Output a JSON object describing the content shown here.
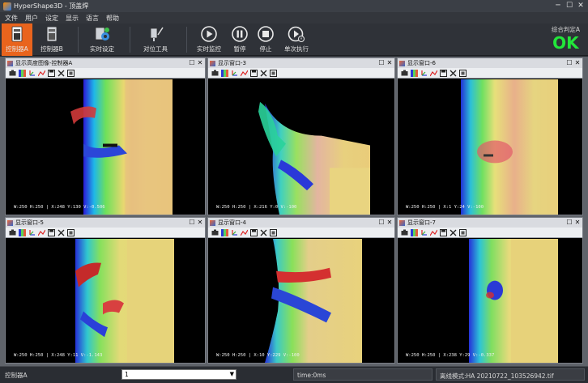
{
  "window": {
    "title": "HyperShape3D - 顶盖焊"
  },
  "menu": [
    "文件",
    "用户",
    "设定",
    "显示",
    "语言",
    "帮助"
  ],
  "toolbar": {
    "buttons": [
      {
        "label": "控制器A",
        "icon": "controller-icon",
        "active": true
      },
      {
        "label": "控制器B",
        "icon": "controller-icon",
        "active": false
      },
      {
        "label": "实时设定",
        "icon": "settings-icon",
        "active": false
      },
      {
        "label": "对位工具",
        "icon": "alignment-tool-icon",
        "active": false
      },
      {
        "label": "实时监控",
        "icon": "play-icon",
        "active": false
      },
      {
        "label": "暂停",
        "icon": "pause-icon",
        "active": false
      },
      {
        "label": "停止",
        "icon": "stop-icon",
        "active": false
      },
      {
        "label": "单次执行",
        "icon": "single-run-icon",
        "active": false
      }
    ]
  },
  "verdict": {
    "label": "综合判定A",
    "value": "OK",
    "color": "#22e63a"
  },
  "panes": [
    {
      "title": "显示高度图像-控制器A",
      "readout": "W:250 H:250  |  X:248 Y:130 V:-0.506",
      "variant": "a"
    },
    {
      "title": "显示窗口-3",
      "readout": "W:250 H:250  |  X:216 Y:0 V:-100",
      "variant": "b"
    },
    {
      "title": "显示窗口-6",
      "readout": "W:250 H:250  |  X:1 Y:24 V:-100",
      "variant": "c"
    },
    {
      "title": "显示窗口-5",
      "readout": "W:250 H:250  |  X:248 Y:11 V:-1.143",
      "variant": "d"
    },
    {
      "title": "显示窗口-4",
      "readout": "W:250 H:250  |  X:10 Y:229 V:-100",
      "variant": "e"
    },
    {
      "title": "显示窗口-7",
      "readout": "W:250 H:250  |  X:238 Y:29 V:-0.337",
      "variant": "f"
    }
  ],
  "pane_tool_icons": [
    "camera-icon",
    "color-map-icon",
    "axis-icon",
    "profile-icon",
    "save-icon",
    "clear-icon",
    "fit-icon"
  ],
  "status": {
    "controller": "控制器A",
    "selected": "1",
    "time": "time:0ms",
    "mode": "离线模式:HA  20210722_103526942.tif"
  }
}
